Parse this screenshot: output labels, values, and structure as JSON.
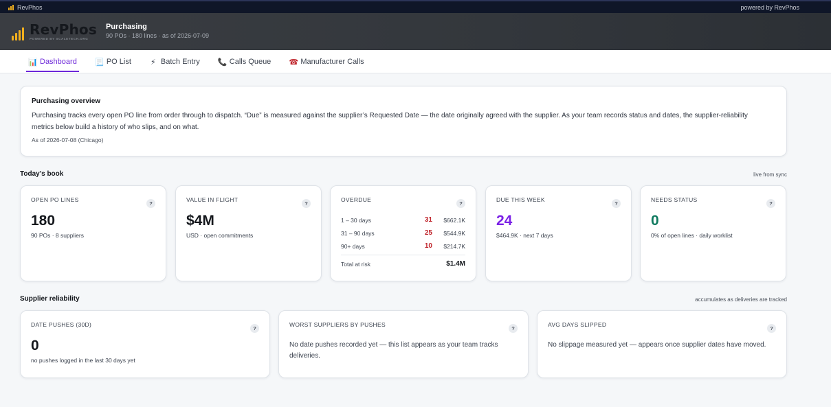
{
  "topbar": {
    "app_name": "RevPhos",
    "powered": "powered by RevPhos"
  },
  "header": {
    "brand": "RevPhos",
    "brand_sub": "POWERED BY SCALETECH.ORG",
    "title": "Purchasing",
    "meta": "90 POs · 180 lines · as of 2026-07-09"
  },
  "nav": {
    "tabs": [
      {
        "icon": "📊",
        "label": "Dashboard"
      },
      {
        "icon": "📃",
        "label": "PO List"
      },
      {
        "icon": "⚡",
        "label": "Batch Entry"
      },
      {
        "icon": "📞",
        "label": "Calls Queue"
      },
      {
        "icon": "☎",
        "label": "Manufacturer Calls"
      }
    ]
  },
  "overview": {
    "title": "Purchasing overview",
    "body": "Purchasing tracks every open PO line from order through to dispatch. “Due” is measured against the supplier’s Requested Date — the date originally agreed with the supplier. As your team records status and dates, the supplier-reliability metrics below build a history of who slips, and on what.",
    "asof": "As of 2026-07-08 (Chicago)"
  },
  "book": {
    "title": "Today’s book",
    "note": "live from sync",
    "help": "?",
    "open_lines": {
      "label": "OPEN PO LINES",
      "value": "180",
      "sub": "90 POs · 8 suppliers"
    },
    "value_in_flight": {
      "label": "VALUE IN FLIGHT",
      "value": "$4M",
      "sub": "USD · open commitments"
    },
    "overdue": {
      "label": "OVERDUE",
      "rows": [
        {
          "range": "1 – 30 days",
          "count": "31",
          "amount": "$662.1K"
        },
        {
          "range": "31 – 90 days",
          "count": "25",
          "amount": "$544.9K"
        },
        {
          "range": "90+ days",
          "count": "10",
          "amount": "$214.7K"
        }
      ],
      "total_label": "Total at risk",
      "total_value": "$1.4M"
    },
    "due_this_week": {
      "label": "DUE THIS WEEK",
      "value": "24",
      "sub": "$464.9K · next 7 days"
    },
    "needs_status": {
      "label": "NEEDS STATUS",
      "value": "0",
      "sub": "0% of open lines · daily worklist"
    }
  },
  "reliability": {
    "title": "Supplier reliability",
    "note": "accumulates as deliveries are tracked",
    "date_pushes": {
      "label": "DATE PUSHES (30D)",
      "value": "0",
      "sub": "no pushes logged in the last 30 days yet"
    },
    "worst_suppliers": {
      "label": "WORST SUPPLIERS BY PUSHES",
      "empty": "No date pushes recorded yet — this list appears as your team tracks deliveries."
    },
    "avg_days": {
      "label": "AVG DAYS SLIPPED",
      "empty": "No slippage measured yet — appears once supplier dates have moved."
    }
  },
  "colors": {
    "accent": "#6d28d9",
    "due_value": "#7c22e6",
    "needs_value": "#0f7a5f",
    "overdue_count": "#c0262d",
    "brand_gold": "#f2b01e"
  }
}
